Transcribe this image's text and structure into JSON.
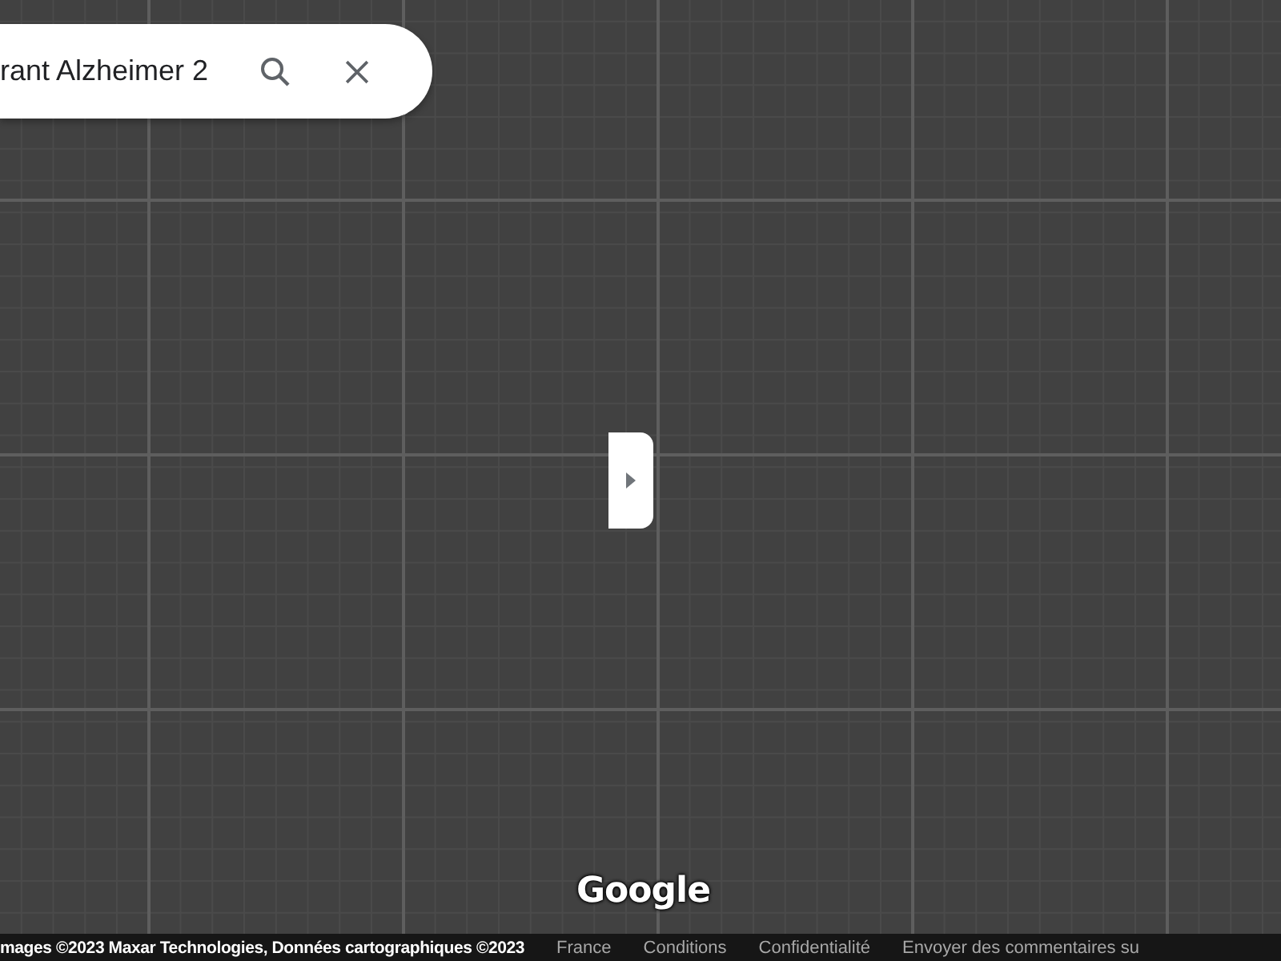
{
  "search": {
    "value": "rant Alzheimer 2"
  },
  "logo": "Google",
  "footer": {
    "attribution": "mages ©2023 Maxar Technologies, Données cartographiques ©2023",
    "links": [
      "France",
      "Conditions",
      "Confidentialité",
      "Envoyer des commentaires su"
    ]
  }
}
